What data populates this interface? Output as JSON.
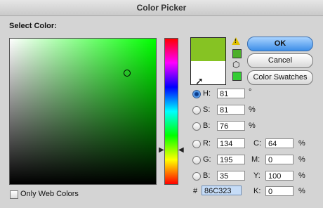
{
  "window": {
    "title": "Color Picker"
  },
  "select_color_label": "Select Color:",
  "colors": {
    "new_color": "#86C323",
    "current_color": "#FFFFFF",
    "gamut_swatch": "#4CAF2A",
    "web_swatch": "#33CC33"
  },
  "buttons": {
    "ok": "OK",
    "cancel": "Cancel",
    "color_swatches": "Color Swatches"
  },
  "hsb": {
    "h_label": "H:",
    "h_value": "81",
    "h_unit": "°",
    "s_label": "S:",
    "s_value": "81",
    "s_unit": "%",
    "b_label": "B:",
    "b_value": "76",
    "b_unit": "%"
  },
  "rgb": {
    "r_label": "R:",
    "r_value": "134",
    "g_label": "G:",
    "g_value": "195",
    "b_label": "B:",
    "b_value": "35"
  },
  "cmyk": {
    "c_label": "C:",
    "c_value": "64",
    "c_unit": "%",
    "m_label": "M:",
    "m_value": "0",
    "m_unit": "%",
    "y_label": "Y:",
    "y_value": "100",
    "y_unit": "%",
    "k_label": "K:",
    "k_value": "0",
    "k_unit": "%"
  },
  "hex": {
    "label": "#",
    "value": "86C323"
  },
  "only_web_colors": {
    "label": "Only Web Colors",
    "checked": false
  }
}
